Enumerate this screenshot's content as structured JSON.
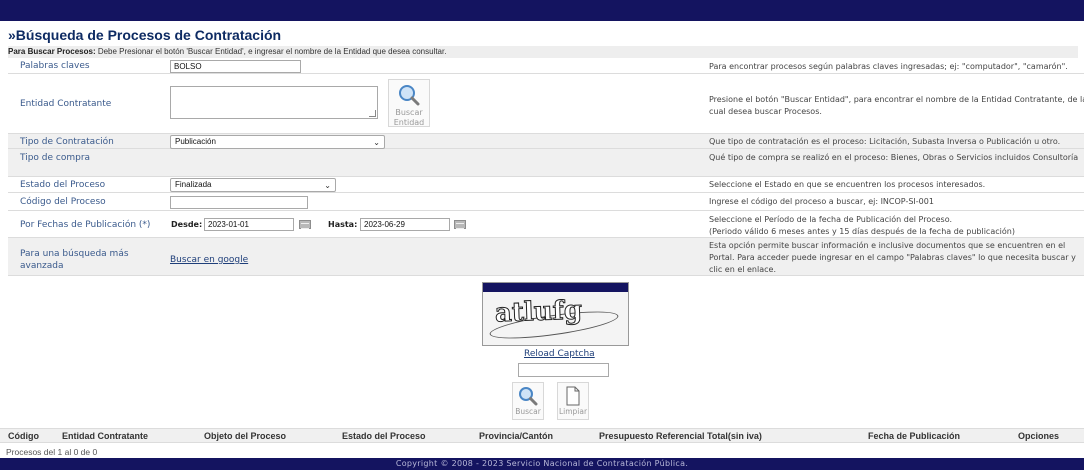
{
  "page": {
    "title": "»Búsqueda de Procesos de Contratación",
    "instructions_bold": "Para Buscar Procesos:",
    "instructions_text": " Debe Presionar el botón 'Buscar Entidad', e ingresar el nombre de la Entidad que desea consultar."
  },
  "form": {
    "keywords": {
      "label": "Palabras claves",
      "value": "BOLSO",
      "hint": "Para encontrar procesos según palabras claves ingresadas; ej: \"computador\", \"camarón\"."
    },
    "entity": {
      "label": "Entidad Contratante",
      "button_line1": "Buscar",
      "button_line2": "Entidad",
      "hint": "Presione el botón \"Buscar Entidad\", para encontrar el nombre de la Entidad Contratante, de la cual desea buscar Procesos."
    },
    "contract_type": {
      "label": "Tipo de Contratación",
      "selected": "Publicación",
      "hint": "Que tipo de contratación es el proceso: Licitación, Subasta Inversa o Publicación u otro."
    },
    "purchase_type": {
      "label": "Tipo de compra",
      "hint": "Qué tipo de compra se realizó en el proceso: Bienes, Obras o Servicios incluidos Consultoría"
    },
    "status": {
      "label": "Estado del Proceso",
      "selected": "Finalizada",
      "hint": "Seleccione el Estado en que se encuentren los procesos interesados."
    },
    "code": {
      "label": "Código del Proceso",
      "value": "",
      "hint": "Ingrese el código del proceso a buscar, ej: INCOP-SI-001"
    },
    "dates": {
      "label": "Por Fechas de Publicación (*)",
      "from_label": "Desde:",
      "from_value": "2023-01-01",
      "to_label": "Hasta:",
      "to_value": "2023-06-29",
      "hint_line1": "Seleccione el Período de la fecha de Publicación del Proceso.",
      "hint_line2": "(Periodo válido 6 meses antes y 15 días después de la fecha de publicación)"
    },
    "advanced": {
      "label": "Para una búsqueda más avanzada",
      "link": "Buscar en google",
      "hint": "Esta opción permite buscar información e inclusive documentos que se encuentren en el Portal. Para acceder puede ingresar en el campo \"Palabras claves\" lo que necesita buscar y clic en el enlace."
    }
  },
  "captcha": {
    "text": "atlufg",
    "reload": "Reload Captcha",
    "input_value": ""
  },
  "buttons": {
    "search": "Buscar",
    "clear": "Limpiar"
  },
  "results": {
    "columns": [
      "Código",
      "Entidad Contratante",
      "Objeto del Proceso",
      "Estado del Proceso",
      "Provincia/Cantón",
      "Presupuesto Referencial Total(sin iva)",
      "Fecha de Publicación",
      "Opciones"
    ],
    "count_text": "Procesos del 1 al 0 de 0"
  },
  "footer": {
    "text": "Copyright © 2008 - 2023 Servicio Nacional de Contratación Pública."
  },
  "icons": {
    "search": "magnifier-icon",
    "clear": "document-icon",
    "calendar": "calendar-icon"
  },
  "colors": {
    "header_bar": "#141460",
    "title": "#0e2b63",
    "label": "#3a5a8c"
  }
}
